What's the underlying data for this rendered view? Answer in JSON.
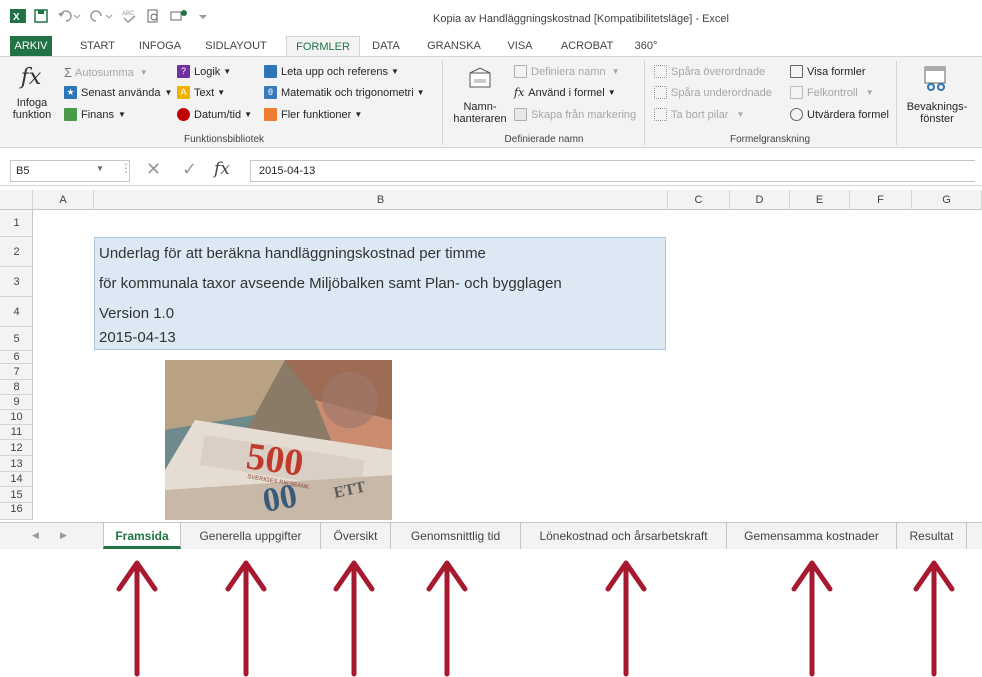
{
  "titlebar": {
    "title": "Kopia av Handläggningskostnad  [Kompatibilitetsläge] - Excel"
  },
  "ribbon_tabs": [
    "ARKIV",
    "START",
    "INFOGA",
    "SIDLAYOUT",
    "FORMLER",
    "DATA",
    "GRANSKA",
    "VISA",
    "ACROBAT",
    "360°"
  ],
  "active_tab": "FORMLER",
  "ribbon": {
    "funktionsbibliotek": {
      "insert_function_line1": "Infoga",
      "insert_function_line2": "funktion",
      "autosum": "Autosumma",
      "recent": "Senast använda",
      "finance": "Finans",
      "logic": "Logik",
      "text": "Text",
      "datetime": "Datum/tid",
      "lookup": "Leta upp och referens",
      "math": "Matematik och trigonometri",
      "more": "Fler funktioner",
      "group_label": "Funktionsbibliotek"
    },
    "definierade_namn": {
      "name_manager_line1": "Namn-",
      "name_manager_line2": "hanteraren",
      "define_name": "Definiera namn",
      "use_in_formula": "Använd i formel",
      "create_from_selection": "Skapa från markering",
      "group_label": "Definierade namn"
    },
    "formelgranskning": {
      "trace_precedents": "Spåra överordnade",
      "trace_dependents": "Spåra underordnade",
      "remove_arrows": "Ta bort pilar",
      "show_formulas": "Visa formler",
      "error_checking": "Felkontroll",
      "evaluate_formula": "Utvärdera formel",
      "group_label": "Formelgranskning"
    },
    "watch_window_line1": "Bevaknings-",
    "watch_window_line2": "fönster"
  },
  "formula_bar": {
    "name_box": "B5",
    "formula": "2015-04-13"
  },
  "columns": [
    "A",
    "B",
    "C",
    "D",
    "E",
    "F",
    "G"
  ],
  "rows": [
    "1",
    "2",
    "3",
    "4",
    "5",
    "6",
    "7",
    "8",
    "9",
    "10",
    "11",
    "12",
    "13",
    "14",
    "15",
    "16"
  ],
  "cells": {
    "line1": "Underlag för att beräkna handläggningskostnad per timme",
    "line2": "för kommunala taxor avseende Miljöbalken samt Plan- och bygglagen",
    "line3": "Version 1.0",
    "line4": "2015-04-13"
  },
  "photo_text": {
    "denomination": "500",
    "bank": "SVERIGES RIKSBANK",
    "ett": "ETT"
  },
  "sheet_tabs": [
    "Framsida",
    "Generella uppgifter",
    "Översikt",
    "Genomsnittlig tid",
    "Lönekostnad och årsarbetskraft",
    "Gemensamma kostnader",
    "Resultat"
  ],
  "active_sheet": "Framsida",
  "colors": {
    "excel_green": "#217346",
    "arrow_red": "#a6192e",
    "info_fill": "#dce9f5"
  }
}
